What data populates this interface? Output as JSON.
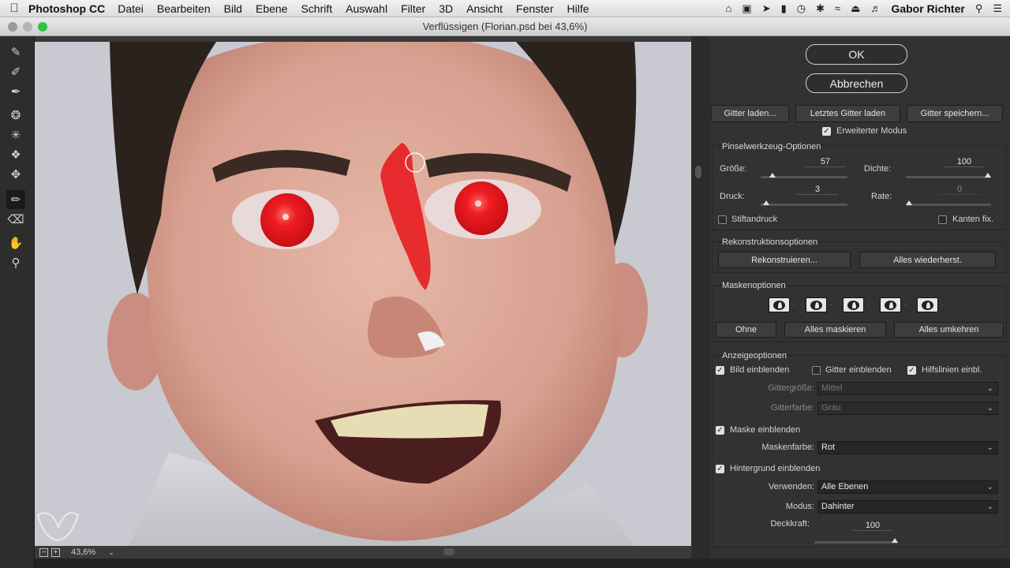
{
  "menubar": {
    "app_name": "Photoshop CC",
    "items": [
      "Datei",
      "Bearbeiten",
      "Bild",
      "Ebene",
      "Schrift",
      "Auswahl",
      "Filter",
      "3D",
      "Ansicht",
      "Fenster",
      "Hilfe"
    ],
    "user": "Gabor Richter"
  },
  "window": {
    "title": "Verflüssigen (Florian.psd bei 43,6%)"
  },
  "statusbar": {
    "zoom": "43,6%"
  },
  "buttons": {
    "ok": "OK",
    "cancel": "Abbrechen"
  },
  "mesh": {
    "load": "Gitter laden...",
    "load_last": "Letztes Gitter laden",
    "save": "Gitter speichern...",
    "advanced_mode": "Erweiterter Modus"
  },
  "brush": {
    "title": "Pinselwerkzeug-Optionen",
    "size_label": "Größe:",
    "size": "57",
    "density_label": "Dichte:",
    "density": "100",
    "pressure_label": "Druck:",
    "pressure": "3",
    "rate_label": "Rate:",
    "rate": "0",
    "stylus": "Stiftandruck",
    "pin_edges": "Kanten fix."
  },
  "reconstruct": {
    "title": "Rekonstruktionsoptionen",
    "reconstruct": "Rekonstruieren...",
    "restore_all": "Alles wiederherst."
  },
  "mask": {
    "title": "Maskenoptionen",
    "none": "Ohne",
    "mask_all": "Alles maskieren",
    "invert_all": "Alles umkehren"
  },
  "view": {
    "title": "Anzeigeoptionen",
    "show_image": "Bild einblenden",
    "show_mesh": "Gitter einblenden",
    "show_guides": "Hilfslinien einbl.",
    "mesh_size_label": "Gittergröße:",
    "mesh_size": "Mittel",
    "mesh_color_label": "Gitterfarbe:",
    "mesh_color": "Grau",
    "show_mask": "Maske einblenden",
    "mask_color_label": "Maskenfarbe:",
    "mask_color": "Rot",
    "show_backdrop": "Hintergrund einblenden",
    "use_label": "Verwenden:",
    "use": "Alle Ebenen",
    "mode_label": "Modus:",
    "mode": "Dahinter",
    "opacity_label": "Deckkraft:",
    "opacity": "100"
  },
  "levels": {
    "size": 0.11,
    "density": 1.0,
    "pressure": 0.03,
    "rate": 0.0,
    "opacity": 1.0
  },
  "colors": {
    "mask_red": "#e8141a",
    "panel_bg": "#323232",
    "canvas_bg": "#c9c9d1"
  }
}
